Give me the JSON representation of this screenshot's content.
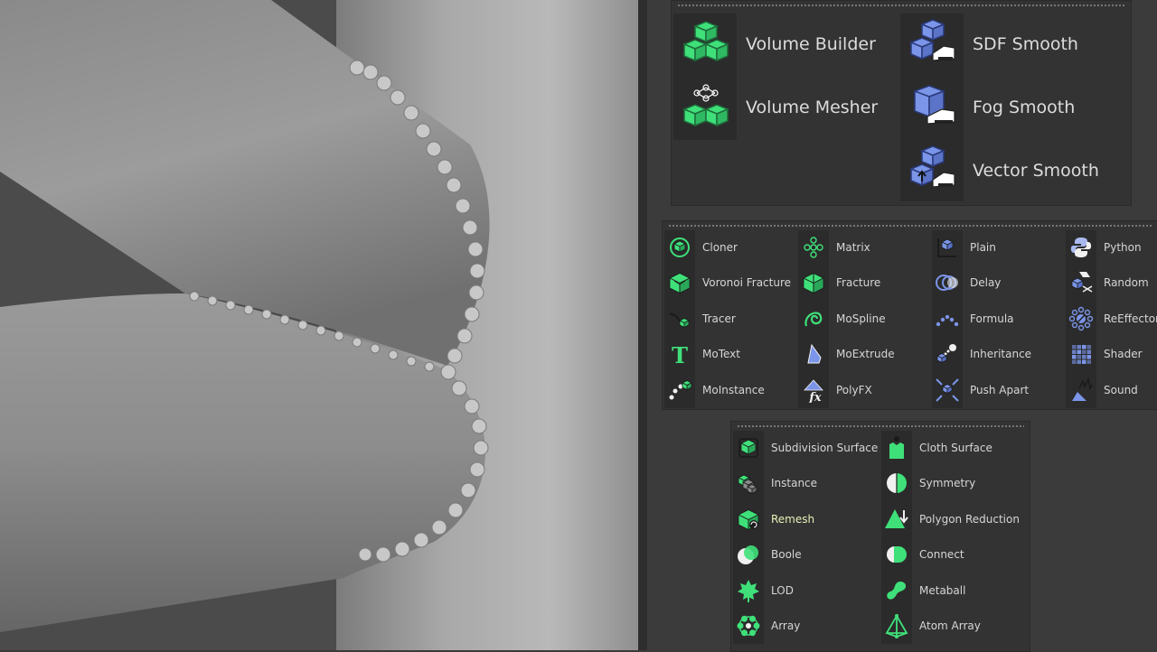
{
  "volume_palette": {
    "items": [
      {
        "label": "Volume Builder",
        "icon": "volume-builder-icon",
        "color": "#3fe07a"
      },
      {
        "label": "Volume Mesher",
        "icon": "volume-mesher-icon",
        "color": "#3fe07a"
      },
      {
        "label": "SDF Smooth",
        "icon": "sdf-smooth-icon",
        "color": "#7b95e8"
      },
      {
        "label": "Fog Smooth",
        "icon": "fog-smooth-icon",
        "color": "#7b95e8"
      },
      {
        "label": "Vector Smooth",
        "icon": "vector-smooth-icon",
        "color": "#7b95e8"
      }
    ]
  },
  "mograph_palette": {
    "columns": [
      [
        {
          "label": "Cloner",
          "icon": "cloner-icon"
        },
        {
          "label": "Voronoi Fracture",
          "icon": "voronoi-fracture-icon"
        },
        {
          "label": "Tracer",
          "icon": "tracer-icon"
        },
        {
          "label": "MoText",
          "icon": "motext-icon"
        },
        {
          "label": "MoInstance",
          "icon": "moinstance-icon"
        }
      ],
      [
        {
          "label": "Matrix",
          "icon": "matrix-icon"
        },
        {
          "label": "Fracture",
          "icon": "fracture-icon"
        },
        {
          "label": "MoSpline",
          "icon": "mospline-icon"
        },
        {
          "label": "MoExtrude",
          "icon": "moextrude-icon"
        },
        {
          "label": "PolyFX",
          "icon": "polyfx-icon"
        }
      ],
      [
        {
          "label": "Plain",
          "icon": "plain-effector-icon"
        },
        {
          "label": "Delay",
          "icon": "delay-effector-icon"
        },
        {
          "label": "Formula",
          "icon": "formula-effector-icon"
        },
        {
          "label": "Inheritance",
          "icon": "inheritance-effector-icon"
        },
        {
          "label": "Push Apart",
          "icon": "push-apart-effector-icon"
        }
      ],
      [
        {
          "label": "Python",
          "icon": "python-effector-icon"
        },
        {
          "label": "Random",
          "icon": "random-effector-icon"
        },
        {
          "label": "ReEffector",
          "icon": "reeffector-icon"
        },
        {
          "label": "Shader",
          "icon": "shader-effector-icon"
        },
        {
          "label": "Sound",
          "icon": "sound-effector-icon"
        }
      ]
    ],
    "generator_color": "#3fe07a",
    "effector_color": "#7b95e8"
  },
  "generators_palette": {
    "columns": [
      [
        {
          "label": "Subdivision Surface",
          "icon": "subdivision-surface-icon"
        },
        {
          "label": "Instance",
          "icon": "instance-icon"
        },
        {
          "label": "Remesh",
          "icon": "remesh-icon",
          "highlight": true
        },
        {
          "label": "Boole",
          "icon": "boole-icon"
        },
        {
          "label": "LOD",
          "icon": "lod-icon"
        },
        {
          "label": "Array",
          "icon": "array-icon"
        }
      ],
      [
        {
          "label": "Cloth Surface",
          "icon": "cloth-surface-icon"
        },
        {
          "label": "Symmetry",
          "icon": "symmetry-icon"
        },
        {
          "label": "Polygon Reduction",
          "icon": "polygon-reduction-icon"
        },
        {
          "label": "Connect",
          "icon": "connect-icon"
        },
        {
          "label": "Metaball",
          "icon": "metaball-icon"
        },
        {
          "label": "Atom Array",
          "icon": "atom-array-icon"
        }
      ]
    ],
    "color": "#3fe07a"
  }
}
